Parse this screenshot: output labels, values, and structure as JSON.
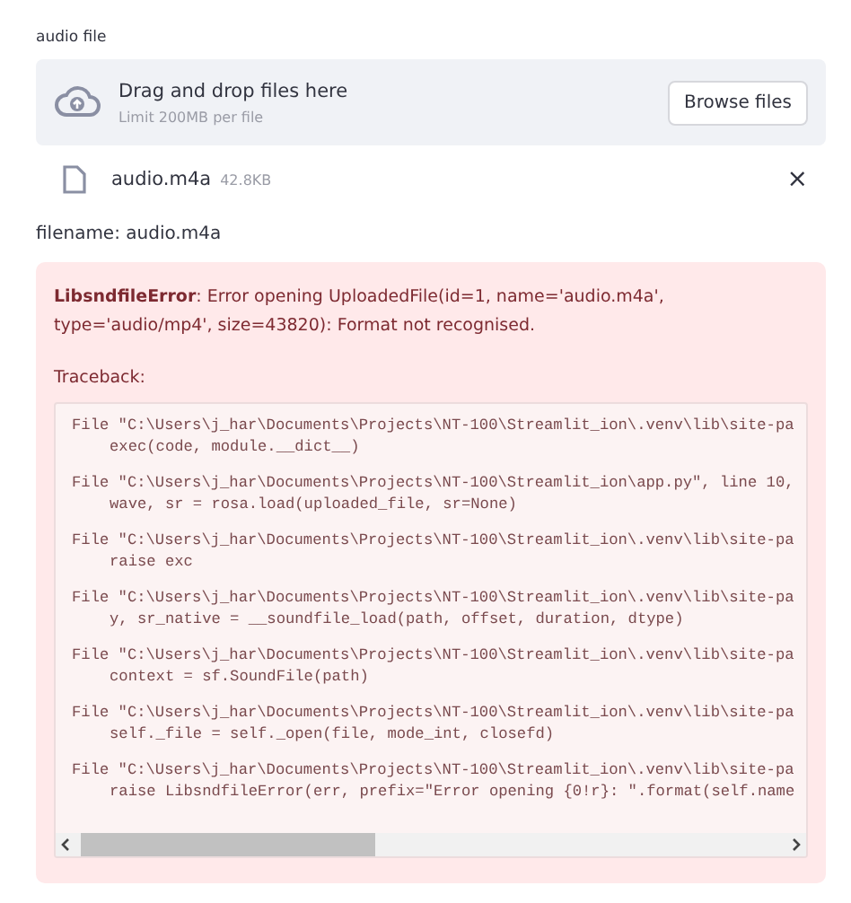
{
  "uploader": {
    "label": "audio file",
    "instruction": "Drag and drop files here",
    "limit": "Limit 200MB per file",
    "button": "Browse files"
  },
  "file": {
    "name": "audio.m4a",
    "size": "42.8KB",
    "remove": "×"
  },
  "filename_text": "filename: audio.m4a",
  "error": {
    "message": "**LibsndfileError**: Error opening UploadedFile(id=1, name='audio.m4a', type='audio/mp4', size=43820): Format not recognised.",
    "traceback_label": "Traceback:",
    "frames": [
      {
        "file": "File \"C:\\Users\\j_har\\Documents\\Projects\\NT-100\\Streamlit_ion\\.venv\\lib\\site-pa",
        "code": "exec(code, module.__dict__)"
      },
      {
        "file": "File \"C:\\Users\\j_har\\Documents\\Projects\\NT-100\\Streamlit_ion\\app.py\", line 10,",
        "code": "wave, sr = rosa.load(uploaded_file, sr=None)"
      },
      {
        "file": "File \"C:\\Users\\j_har\\Documents\\Projects\\NT-100\\Streamlit_ion\\.venv\\lib\\site-pa",
        "code": "raise exc"
      },
      {
        "file": "File \"C:\\Users\\j_har\\Documents\\Projects\\NT-100\\Streamlit_ion\\.venv\\lib\\site-pa",
        "code": "y, sr_native = __soundfile_load(path, offset, duration, dtype)"
      },
      {
        "file": "File \"C:\\Users\\j_har\\Documents\\Projects\\NT-100\\Streamlit_ion\\.venv\\lib\\site-pa",
        "code": "context = sf.SoundFile(path)"
      },
      {
        "file": "File \"C:\\Users\\j_har\\Documents\\Projects\\NT-100\\Streamlit_ion\\.venv\\lib\\site-pa",
        "code": "self._file = self._open(file, mode_int, closefd)"
      },
      {
        "file": "File \"C:\\Users\\j_har\\Documents\\Projects\\NT-100\\Streamlit_ion\\.venv\\lib\\site-pa",
        "code": "raise LibsndfileError(err, prefix=\"Error opening {0!r}: \".format(self.name"
      }
    ]
  }
}
